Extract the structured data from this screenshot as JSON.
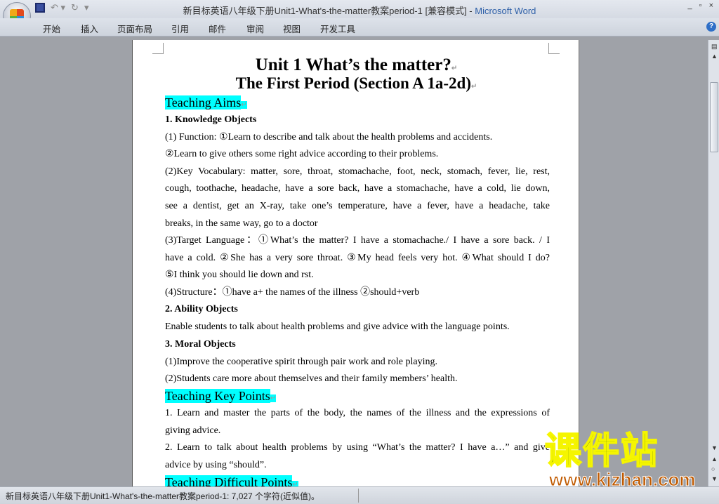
{
  "window": {
    "title": "新目标英语八年级下册Unit1-What's-the-matter教案period-1 [兼容模式] - ",
    "app": "Microsoft Word",
    "minimize": "_",
    "restore": "▫",
    "close": "×"
  },
  "ribbon": {
    "tabs": [
      "开始",
      "插入",
      "页面布局",
      "引用",
      "邮件",
      "审阅",
      "视图",
      "开发工具"
    ],
    "help": "?"
  },
  "document": {
    "title": "Unit 1 What’s the matter?",
    "subtitle": "The First Period (Section A 1a-2d)",
    "lines": [
      "1. Knowledge Objects",
      "(1) Function: ①Learn to describe and talk about the health problems and accidents.",
      "②Learn to give others some right advice according to their problems.",
      "(2)Key Vocabulary: matter, sore, throat, stomachache, foot, neck, stomach, fever, lie, rest,",
      "cough, toothache, headache, have a sore back, have a stomachache, have a cold, lie down,",
      "see a dentist, get an X-ray, take one’s temperature, have a fever, have a headache, take",
      "breaks, in the same way, go to a doctor",
      "(3)Target Language：①What’s the matter? I have a stomachache./ I have a sore back. / I",
      "have a cold. ②She has a very sore throat.  ③My head feels very hot. ④What should I do?",
      "⑤I think you should lie down and rst.",
      "(4)Structure：①have a+ the names of the illness ②should+verb",
      "2. Ability Objects",
      "Enable students to talk about health problems and give advice with the language points.",
      "3. Moral Objects",
      "(1)Improve the cooperative spirit through pair work and role playing.",
      "(2)Students care more about themselves and their family members’ health.",
      "1. Learn and master the parts of the body, the names of the illness and the expressions of",
      "giving advice.",
      "2. Learn to talk about health problems by using “What’s the matter? I have a…” and give",
      "advice by using “should”."
    ],
    "headings": [
      "Teaching Aims",
      "Teaching Key Points",
      "Teaching Difficult Points"
    ]
  },
  "status": {
    "text": "新目标英语八年级下册Unit1-What's-the-matter教案period-1: 7,027 个字符(近似值)。"
  },
  "watermark": {
    "cn": "课件站",
    "url": "www.kjzhan.com"
  }
}
